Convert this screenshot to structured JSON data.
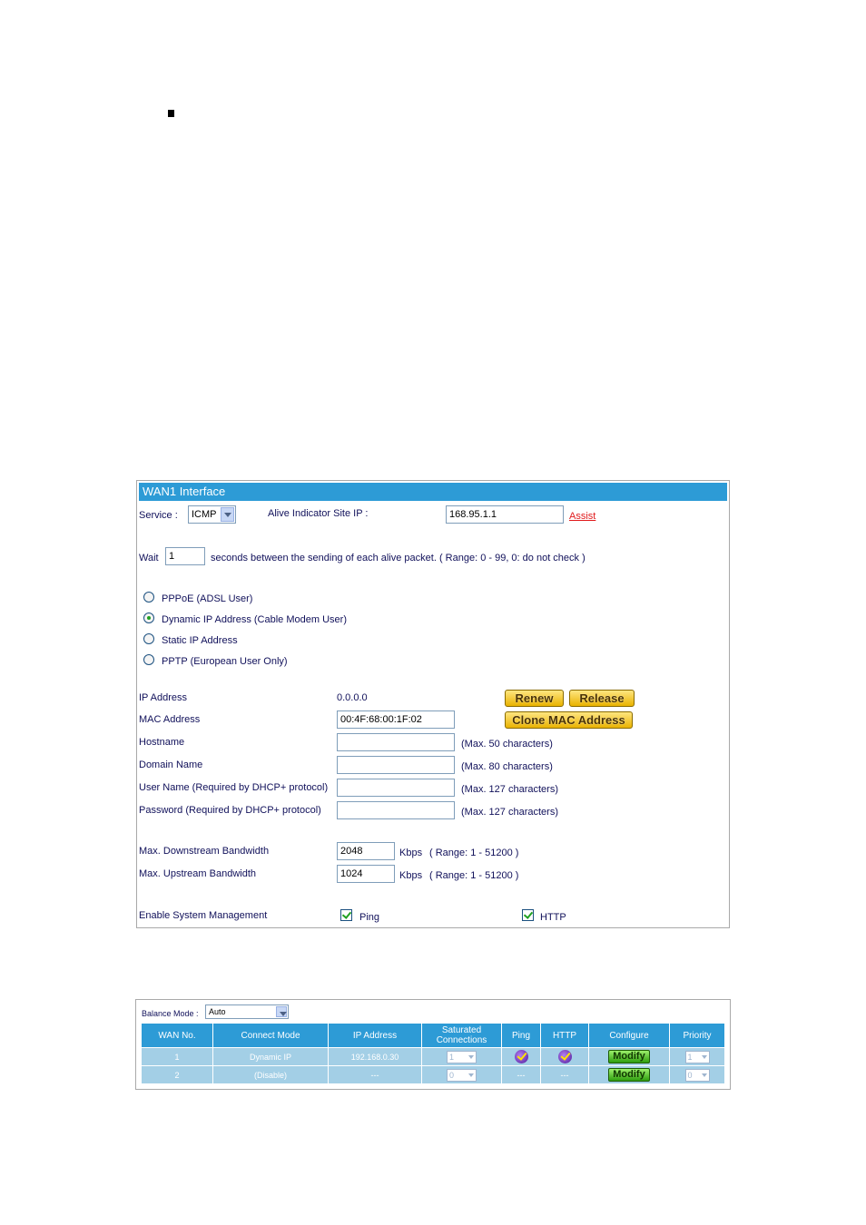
{
  "wan1": {
    "title": "WAN1 Interface",
    "service_label": "Service :",
    "service_value": "ICMP",
    "alive_label": "Alive Indicator Site IP :",
    "alive_value": "168.95.1.1",
    "assist_link": "Assist",
    "wait_label": "Wait",
    "wait_value": "1",
    "wait_suffix": "seconds between the sending of each alive packet. ( Range: 0 - 99, 0: do not check )",
    "modes": [
      {
        "label": "PPPoE (ADSL User)",
        "selected": false
      },
      {
        "label": "Dynamic IP Address (Cable Modem User)",
        "selected": true
      },
      {
        "label": "Static IP Address",
        "selected": false
      },
      {
        "label": "PPTP (European User Only)",
        "selected": false
      }
    ],
    "ip_label": "IP Address",
    "ip_value": "0.0.0.0",
    "renew_button": "Renew",
    "release_button": "Release",
    "mac_label": "MAC Address",
    "mac_value": "00:4F:68:00:1F:02",
    "clone_button": "Clone MAC Address",
    "hostname_label": "Hostname",
    "hostname_hint": "(Max. 50 characters)",
    "domain_label": "Domain Name",
    "domain_hint": "(Max. 80 characters)",
    "username_label": "User Name (Required by DHCP+ protocol)",
    "username_hint": "(Max. 127 characters)",
    "password_label": "Password (Required by DHCP+ protocol)",
    "password_hint": "(Max. 127 characters)",
    "down_label": "Max. Downstream Bandwidth",
    "down_value": "2048",
    "down_unit": "Kbps",
    "down_range": "( Range: 1 - 51200 )",
    "up_label": "Max. Upstream Bandwidth",
    "up_value": "1024",
    "up_unit": "Kbps",
    "up_range": "( Range: 1 - 51200 )",
    "mgmt_label": "Enable System Management",
    "ping_label": "Ping",
    "ping_checked": true,
    "http_label": "HTTP",
    "http_checked": true
  },
  "balance": {
    "mode_label": "Balance Mode :",
    "mode_value": "Auto",
    "headers": [
      "WAN No.",
      "Connect Mode",
      "IP Address",
      "Saturated Connections",
      "Ping",
      "HTTP",
      "Configure",
      "Priority"
    ],
    "rows": [
      {
        "wan": "1",
        "mode": "Dynamic IP",
        "ip": "192.168.0.30",
        "saturated": "1",
        "ping": "icon",
        "http": "icon",
        "configure": "Modify",
        "priority": "1"
      },
      {
        "wan": "2",
        "mode": "(Disable)",
        "ip": "---",
        "saturated": "0",
        "ping": "---",
        "http": "---",
        "configure": "Modify",
        "priority": "0"
      }
    ]
  },
  "colors": {
    "header_blue": "#2d9bd6",
    "row_blue": "#a3cfe6",
    "assist_red": "#e0191b"
  }
}
